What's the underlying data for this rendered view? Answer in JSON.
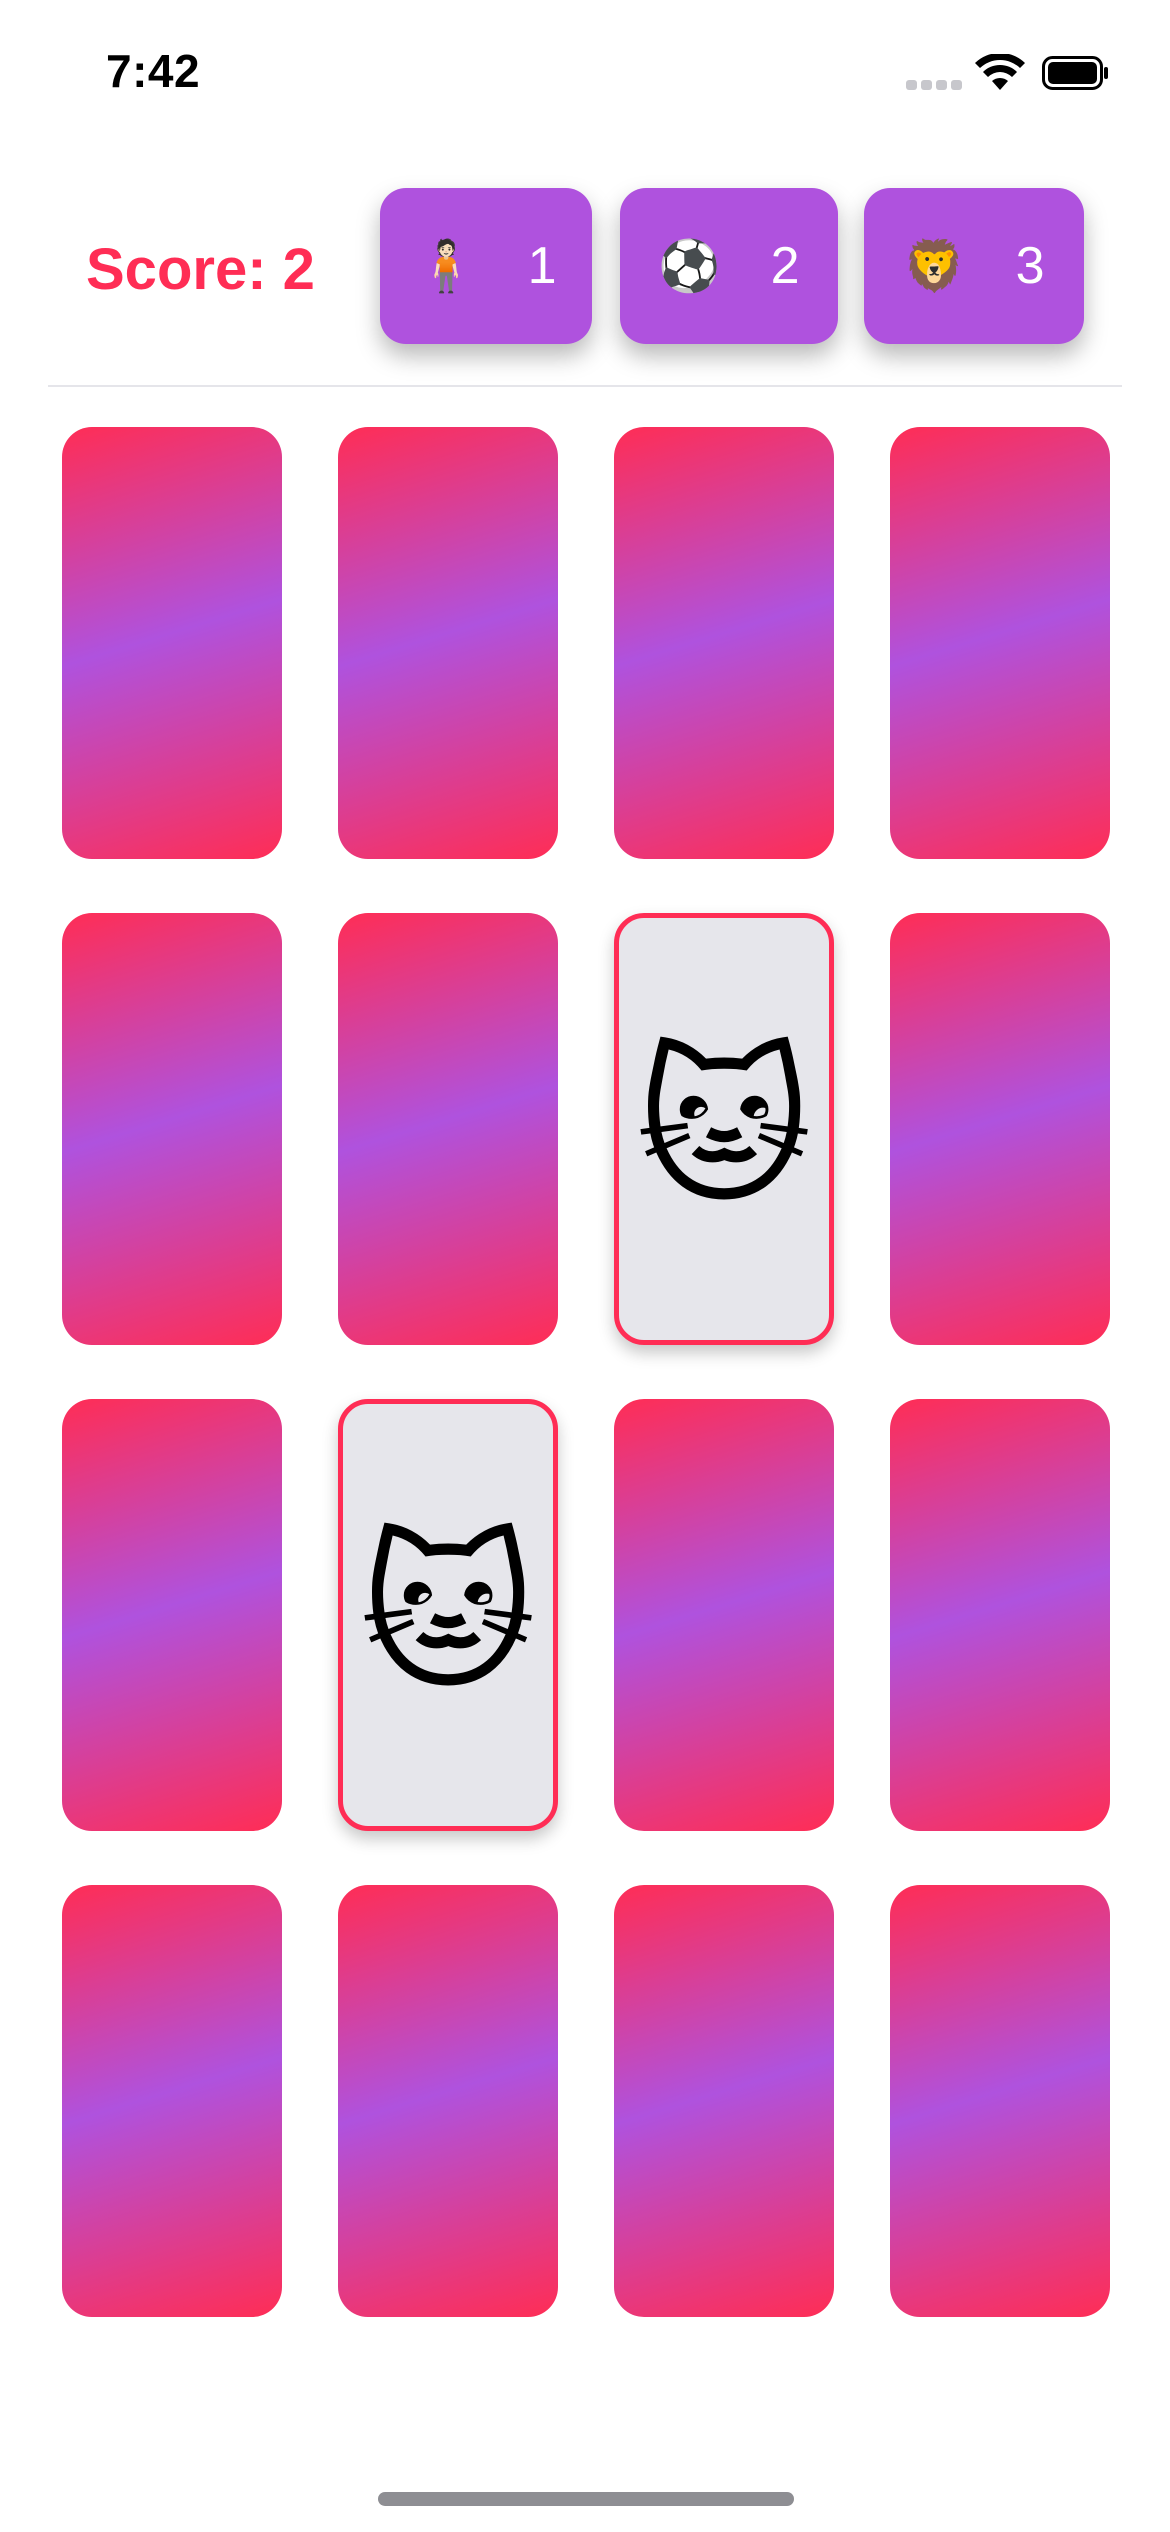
{
  "status_bar": {
    "time": "7:42"
  },
  "header": {
    "score_label": "Score: 2",
    "themes": [
      {
        "emoji": "🧍🏻",
        "icon_name": "person-standing-icon",
        "count": "1"
      },
      {
        "emoji": "⚽️",
        "icon_name": "soccer-ball-icon",
        "count": "2"
      },
      {
        "emoji": "🦁",
        "icon_name": "lion-icon",
        "count": "3"
      }
    ]
  },
  "colors": {
    "accent": "#ff2d55",
    "theme_button": "#af52de",
    "card_gradient": [
      "#ff2d55",
      "#af52de",
      "#ff2d55"
    ],
    "face_up_bg": "#e6e6eb"
  },
  "grid": {
    "columns": 4,
    "cards": [
      {
        "state": "face-down"
      },
      {
        "state": "face-down"
      },
      {
        "state": "face-down"
      },
      {
        "state": "face-down"
      },
      {
        "state": "face-down"
      },
      {
        "state": "face-down"
      },
      {
        "state": "face-up",
        "emoji": "🐱",
        "icon_name": "cat-face-icon"
      },
      {
        "state": "face-down"
      },
      {
        "state": "face-down"
      },
      {
        "state": "face-up",
        "emoji": "🐱",
        "icon_name": "cat-face-icon"
      },
      {
        "state": "face-down"
      },
      {
        "state": "face-down"
      },
      {
        "state": "face-down"
      },
      {
        "state": "face-down"
      },
      {
        "state": "face-down"
      },
      {
        "state": "face-down"
      }
    ]
  }
}
